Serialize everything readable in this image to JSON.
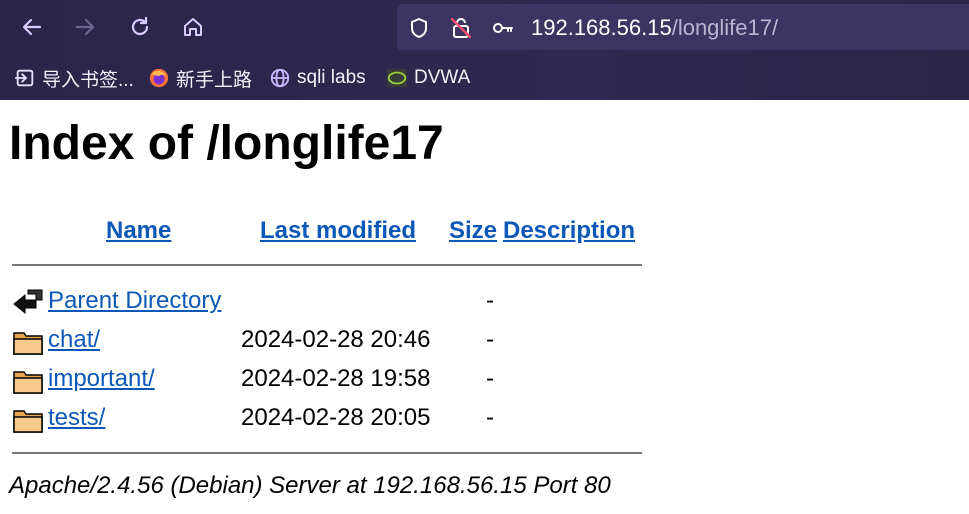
{
  "browser": {
    "url_host": "192.168.56.15",
    "url_path": "/longlife17/",
    "bookmarks": [
      {
        "label": "导入书签...",
        "icon": "import-icon"
      },
      {
        "label": "新手上路",
        "icon": "firefox-icon"
      },
      {
        "label": "sqli labs",
        "icon": "globe-icon"
      },
      {
        "label": "DVWA",
        "icon": "dvwa-icon"
      }
    ]
  },
  "page": {
    "title": "Index of /longlife17",
    "columns": {
      "name": "Name",
      "last_modified": "Last modified",
      "size": "Size",
      "description": "Description"
    },
    "rows": [
      {
        "name": "Parent Directory",
        "modified": "",
        "size": "-",
        "icon": "back-arrow-icon"
      },
      {
        "name": "chat/",
        "modified": "2024-02-28 20:46",
        "size": "-",
        "icon": "folder-icon"
      },
      {
        "name": "important/",
        "modified": "2024-02-28 19:58",
        "size": "-",
        "icon": "folder-icon"
      },
      {
        "name": "tests/",
        "modified": "2024-02-28 20:05",
        "size": "-",
        "icon": "folder-icon"
      }
    ],
    "footer": "Apache/2.4.56 (Debian) Server at 192.168.56.15 Port 80"
  }
}
